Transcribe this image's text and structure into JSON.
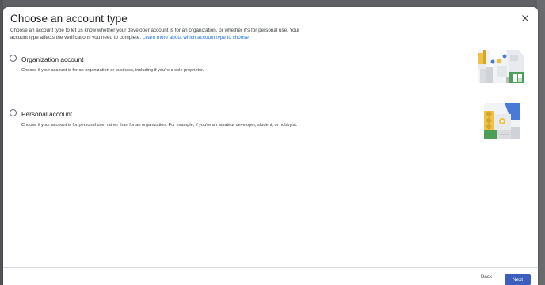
{
  "dialog": {
    "title": "Choose an account type",
    "description": "Choose an account type to let us know whether your developer account is for an organization, or whether it's for personal use. Your account type affects the verifications you need to complete. ",
    "learn_more_link": "Learn more about which account type to choose",
    "close_icon": "close-icon"
  },
  "options": [
    {
      "title": "Organization account",
      "subtitle": "Choose if your account is for an organization or business, including if you're a sole proprietor.",
      "selected": false,
      "illustration": "organization-illustration"
    },
    {
      "title": "Personal account",
      "subtitle": "Choose if your account is for personal use, rather than for an organization. For example, if you're an amateur developer, student, or hobbyist.",
      "selected": false,
      "illustration": "personal-illustration"
    }
  ],
  "footer": {
    "back_label": "Back",
    "next_label": "Next"
  },
  "colors": {
    "accent": "#3c5dbb",
    "link": "#1a73e8",
    "backdrop": "#5f6063"
  }
}
